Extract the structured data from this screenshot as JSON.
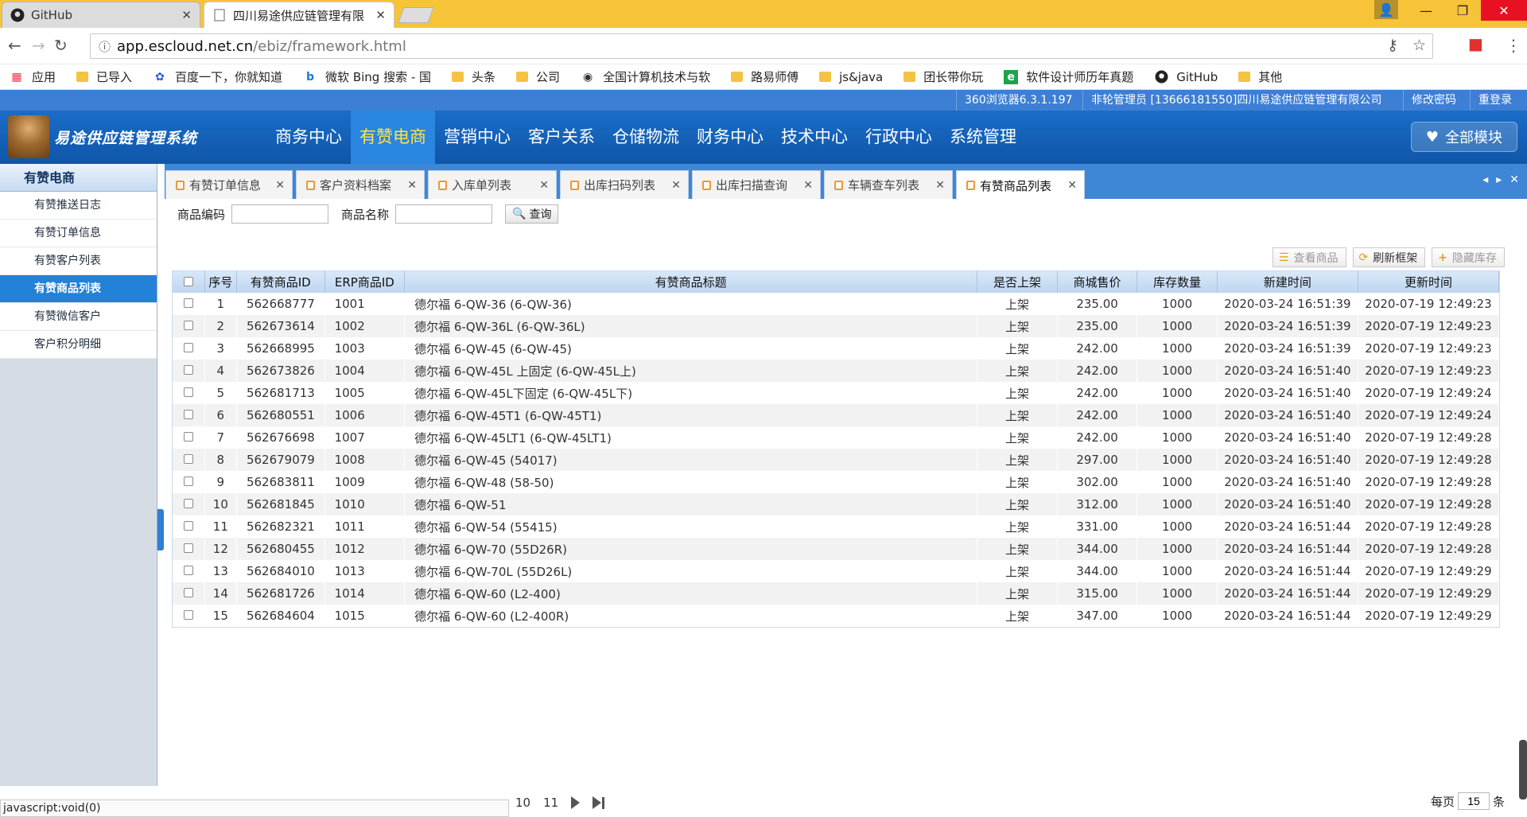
{
  "browser": {
    "tabs": [
      {
        "label": "GitHub",
        "icon": "github-icon"
      },
      {
        "label": "四川易途供应链管理有限",
        "icon": "page-icon"
      }
    ],
    "url_host": "app.escloud.net.cn",
    "url_path": "/ebiz/framework.html",
    "bookmarks": [
      "应用",
      "已导入",
      "百度一下，你就知道",
      "微软 Bing 搜索 - 国",
      "头条",
      "公司",
      "全国计算机技术与软",
      "路易师傅",
      "js&java",
      "团长带你玩",
      "软件设计师历年真题",
      "GitHub",
      "其他"
    ],
    "status": "javascript:void(0)"
  },
  "topbar": {
    "version": "360浏览器6.3.1.197",
    "user": "非轮管理员 [13666181550]四川易途供应链管理有限公司",
    "change_password": "修改密码",
    "relogin": "重登录"
  },
  "header": {
    "system_title": "易途供应链管理系统",
    "nav": [
      "商务中心",
      "有赞电商",
      "营销中心",
      "客户关系",
      "仓储物流",
      "财务中心",
      "技术中心",
      "行政中心",
      "系统管理"
    ],
    "active_nav": "有赞电商",
    "all_modules": "全部模块"
  },
  "sidebar": {
    "title": "有赞电商",
    "items": [
      "有赞推送日志",
      "有赞订单信息",
      "有赞客户列表",
      "有赞商品列表",
      "有赞微信客户",
      "客户积分明细"
    ],
    "active": "有赞商品列表"
  },
  "page_tabs": [
    "有赞订单信息",
    "客户资料档案",
    "入库单列表",
    "出库扫码列表",
    "出库扫描查询",
    "车辆查车列表",
    "有赞商品列表"
  ],
  "active_page_tab": "有赞商品列表",
  "search": {
    "code_label": "商品编码",
    "name_label": "商品名称",
    "query_button": "查询"
  },
  "toolbar": {
    "view": "查看商品",
    "refresh": "刷新框架",
    "hide_stock": "隐藏库存"
  },
  "table": {
    "columns": [
      "序号",
      "有赞商品ID",
      "ERP商品ID",
      "有赞商品标题",
      "是否上架",
      "商城售价",
      "库存数量",
      "新建时间",
      "更新时间"
    ],
    "rows": [
      [
        "1",
        "562668777",
        "1001",
        "德尔福 6-QW-36 (6-QW-36)",
        "上架",
        "235.00",
        "1000",
        "2020-03-24 16:51:39",
        "2020-07-19 12:49:23"
      ],
      [
        "2",
        "562673614",
        "1002",
        "德尔福 6-QW-36L (6-QW-36L)",
        "上架",
        "235.00",
        "1000",
        "2020-03-24 16:51:39",
        "2020-07-19 12:49:23"
      ],
      [
        "3",
        "562668995",
        "1003",
        "德尔福 6-QW-45 (6-QW-45)",
        "上架",
        "242.00",
        "1000",
        "2020-03-24 16:51:39",
        "2020-07-19 12:49:23"
      ],
      [
        "4",
        "562673826",
        "1004",
        "德尔福 6-QW-45L 上固定 (6-QW-45L上)",
        "上架",
        "242.00",
        "1000",
        "2020-03-24 16:51:40",
        "2020-07-19 12:49:23"
      ],
      [
        "5",
        "562681713",
        "1005",
        "德尔福 6-QW-45L下固定 (6-QW-45L下)",
        "上架",
        "242.00",
        "1000",
        "2020-03-24 16:51:40",
        "2020-07-19 12:49:24"
      ],
      [
        "6",
        "562680551",
        "1006",
        "德尔福 6-QW-45T1 (6-QW-45T1)",
        "上架",
        "242.00",
        "1000",
        "2020-03-24 16:51:40",
        "2020-07-19 12:49:24"
      ],
      [
        "7",
        "562676698",
        "1007",
        "德尔福 6-QW-45LT1 (6-QW-45LT1)",
        "上架",
        "242.00",
        "1000",
        "2020-03-24 16:51:40",
        "2020-07-19 12:49:28"
      ],
      [
        "8",
        "562679079",
        "1008",
        "德尔福 6-QW-45 (54017)",
        "上架",
        "297.00",
        "1000",
        "2020-03-24 16:51:40",
        "2020-07-19 12:49:28"
      ],
      [
        "9",
        "562683811",
        "1009",
        "德尔福 6-QW-48 (58-50)",
        "上架",
        "302.00",
        "1000",
        "2020-03-24 16:51:40",
        "2020-07-19 12:49:28"
      ],
      [
        "10",
        "562681845",
        "1010",
        "德尔福 6-QW-51",
        "上架",
        "312.00",
        "1000",
        "2020-03-24 16:51:40",
        "2020-07-19 12:49:28"
      ],
      [
        "11",
        "562682321",
        "1011",
        "德尔福 6-QW-54 (55415)",
        "上架",
        "331.00",
        "1000",
        "2020-03-24 16:51:44",
        "2020-07-19 12:49:28"
      ],
      [
        "12",
        "562680455",
        "1012",
        "德尔福 6-QW-70 (55D26R)",
        "上架",
        "344.00",
        "1000",
        "2020-03-24 16:51:44",
        "2020-07-19 12:49:28"
      ],
      [
        "13",
        "562684010",
        "1013",
        "德尔福 6-QW-70L (55D26L)",
        "上架",
        "344.00",
        "1000",
        "2020-03-24 16:51:44",
        "2020-07-19 12:49:29"
      ],
      [
        "14",
        "562681726",
        "1014",
        "德尔福 6-QW-60 (L2-400)",
        "上架",
        "315.00",
        "1000",
        "2020-03-24 16:51:44",
        "2020-07-19 12:49:29"
      ],
      [
        "15",
        "562684604",
        "1015",
        "德尔福 6-QW-60 (L2-400R)",
        "上架",
        "347.00",
        "1000",
        "2020-03-24 16:51:44",
        "2020-07-19 12:49:29"
      ]
    ]
  },
  "pager": {
    "pages": [
      "10",
      "11"
    ],
    "per_page_label": "每页",
    "per_page": "15",
    "unit": "条"
  },
  "colors": {
    "accent": "#3d7fd4",
    "active_menu": "#2481d8",
    "nav_active_text": "#ffe34d",
    "tab_strip": "#f7c338"
  }
}
